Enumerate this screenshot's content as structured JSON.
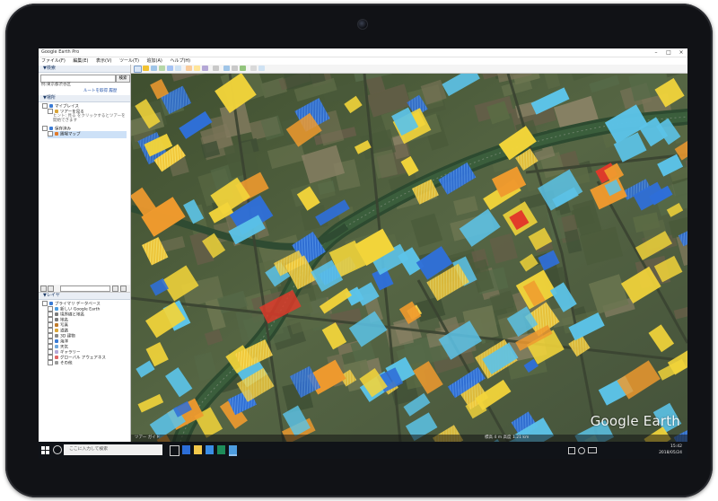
{
  "window": {
    "title": "Google Earth Pro",
    "controls": [
      "–",
      "□",
      "×"
    ]
  },
  "menu": [
    "ファイル(F)",
    "編集(E)",
    "表示(V)",
    "ツール(T)",
    "追加(A)",
    "ヘルプ(H)"
  ],
  "search": {
    "header": "▼検索",
    "placeholder": "例:東京都渋谷区",
    "go_label": "検索",
    "links": "ルートを取得 履歴"
  },
  "places": {
    "header": "▼場所",
    "items": [
      "マイプレイス",
      "ツアーを見る",
      "ヒント: 見る をクリックするとツアーを開始できます",
      "保存済み",
      "圃場マップ"
    ]
  },
  "layers": {
    "header": "▼レイヤ",
    "items": [
      "プライマリ データベース",
      "新しい Google Earth",
      "境界線と地名",
      "地名",
      "写真",
      "道路",
      "3D 建物",
      "海洋",
      "天気",
      "ギャラリー",
      "グローバル アウェアネス",
      "その他"
    ]
  },
  "map": {
    "watermark": "Google Earth",
    "status": "ツアー ガイド",
    "status_right": "標高 4 m   高度 1.21 km"
  },
  "taskbar": {
    "search_placeholder": "ここに入力して検索",
    "time": "15:42",
    "date": "2018/05/24"
  },
  "colors": {
    "map_base": "#4b5a3a",
    "field_blue": "#2f6fd8",
    "field_cyan": "#5cc3e8",
    "field_yellow": "#f2d43a",
    "field_orange": "#ef9a2e",
    "field_red": "#e2392a"
  }
}
